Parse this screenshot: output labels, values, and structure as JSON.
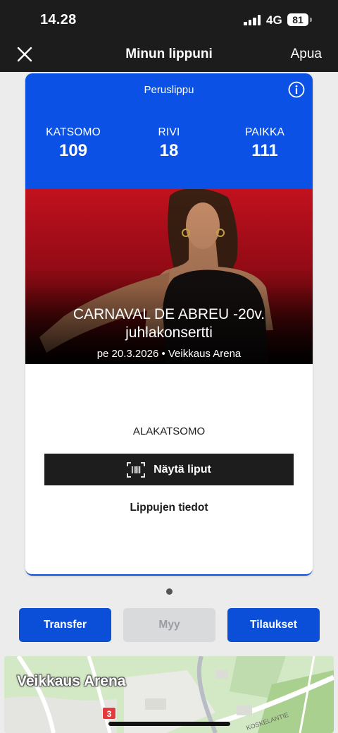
{
  "status_bar": {
    "time": "14.28",
    "network": "4G",
    "battery": "81"
  },
  "nav": {
    "title": "Minun lippuni",
    "help": "Apua",
    "close_icon": "close-icon"
  },
  "ticket": {
    "type": "Peruslippu",
    "info_icon": "info-icon",
    "seat": [
      {
        "label": "KATSOMO",
        "value": "109"
      },
      {
        "label": "RIVI",
        "value": "18"
      },
      {
        "label": "PAIKKA",
        "value": "111"
      }
    ],
    "event_title_line1": "CARNAVAL DE ABREU -20v.",
    "event_title_line2": "juhlakonsertti",
    "event_meta": "pe 20.3.2026 • Veikkaus Arena",
    "section": "ALAKATSOMO",
    "show_button": "Näytä liput",
    "show_button_icon": "barcode-scan-icon",
    "details_link": "Lippujen tiedot"
  },
  "actions": {
    "transfer": "Transfer",
    "sell": "Myy",
    "orders": "Tilaukset"
  },
  "map": {
    "venue_label": "Veikkaus Arena",
    "road_number": "3",
    "street_label": "KOSKELANTIE"
  },
  "colors": {
    "header_blue": "#0b51e6",
    "button_blue": "#0b4fd8",
    "top_bar": "#1c1c1c",
    "event_red": "#c2111e"
  }
}
